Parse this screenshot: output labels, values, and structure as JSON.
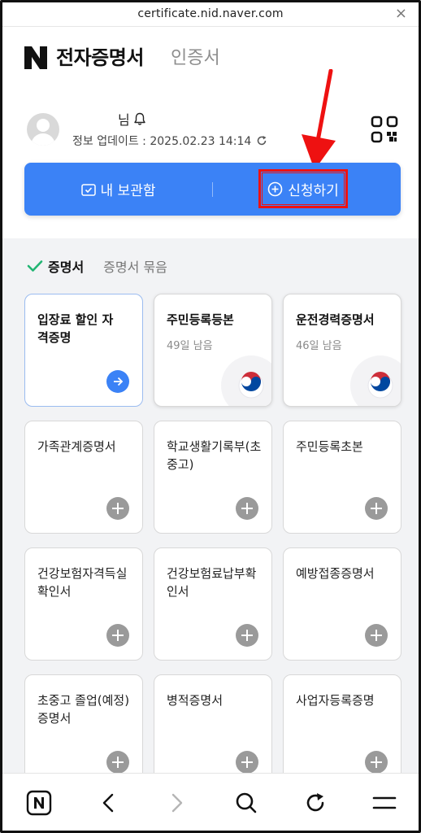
{
  "browser": {
    "url": "certificate.nid.naver.com",
    "close_label": "×"
  },
  "header": {
    "title": "전자증명서",
    "subtitle": "인증서"
  },
  "profile": {
    "name_suffix": "님",
    "update_label": "정보 업데이트 : 2025.02.23 14:14"
  },
  "actions": {
    "storage_label": "내 보관함",
    "apply_label": "신청하기"
  },
  "tabs": {
    "active": "증명서",
    "inactive": "증명서 묶음"
  },
  "cards": [
    {
      "title": "입장료 할인 자격증명",
      "days": "",
      "kind": "featured"
    },
    {
      "title": "주민등록등본",
      "days": "49일 남음",
      "kind": "issued"
    },
    {
      "title": "운전경력증명서",
      "days": "46일 남음",
      "kind": "issued"
    },
    {
      "title": "가족관계증명서",
      "days": "",
      "kind": "add"
    },
    {
      "title": "학교생활기록부(초중고)",
      "days": "",
      "kind": "add"
    },
    {
      "title": "주민등록초본",
      "days": "",
      "kind": "add"
    },
    {
      "title": "건강보험자격득실확인서",
      "days": "",
      "kind": "add"
    },
    {
      "title": "건강보험료납부확인서",
      "days": "",
      "kind": "add"
    },
    {
      "title": "예방접종증명서",
      "days": "",
      "kind": "add"
    },
    {
      "title": "초중고 졸업(예정)증명서",
      "days": "",
      "kind": "add"
    },
    {
      "title": "병적증명서",
      "days": "",
      "kind": "add"
    },
    {
      "title": "사업자등록증명",
      "days": "",
      "kind": "add"
    }
  ],
  "colors": {
    "accent": "#3b82f6",
    "highlight": "#e11111",
    "check": "#22b573"
  },
  "icons": [
    "naver-n-icon",
    "bell-icon",
    "refresh-icon",
    "qr-code-icon",
    "archive-check-icon",
    "plus-circle-icon",
    "check-icon",
    "arrow-right-icon",
    "korea-emblem-icon",
    "plus-icon",
    "back-icon",
    "forward-icon",
    "search-icon",
    "reload-icon",
    "menu-icon"
  ]
}
